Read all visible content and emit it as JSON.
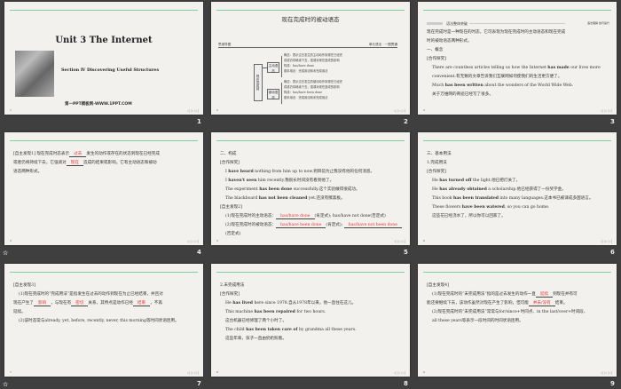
{
  "slide_numbers": [
    "1",
    "2",
    "3",
    "4",
    "5",
    "6",
    "7",
    "8",
    "9"
  ],
  "animation_icon": "star-icon",
  "slide1": {
    "title": "Unit 3    The Internet",
    "subtitle": "Section Ⅳ Discovering Useful Structures",
    "footer": "第一PPT模板网-WWW.1PPT.COM"
  },
  "slide2": {
    "title": "现在完成时的被动语态",
    "header_left": "思维导图",
    "header_right": "单元语法 · 一图贯通",
    "center": "现在完成时",
    "branches": [
      {
        "label": "主动语态",
        "items": [
          "概念：表示过去发生的主动动作到现在已经完",
          "成或仍将继续下去，强调对现在造成的影响",
          "构成：has/have done",
          "基本用法：完成用法和未完成用法"
        ]
      },
      {
        "label": "被动语态",
        "items": [
          "概念：表示过去发生的被动动作到现在已经完",
          "成或仍将继续下去，强调对现在造成的影响",
          "构成：has/have been done",
          "基本用法：完成用法和未完成用法"
        ]
      }
    ]
  },
  "slide3": {
    "header": "语法整体突破",
    "header_right": "语法理解 技巧提升"
  },
  "slides": {
    "3": [
      [
        [
          "  现在完成时是一种现在的时态，它可表现为现在完成时的主动语态和现在完成",
          ""
        ]
      ],
      [
        [
          "时的被动语态两种形式。",
          ""
        ]
      ],
      [
        [
          "一、概念",
          ""
        ]
      ],
      [
        [
          "[合作探究]",
          ""
        ]
      ],
      [
        [
          "There are countless articles telling us how the Internet ",
          ""
        ],
        [
          "has made",
          "b"
        ],
        [
          " our lives more",
          ""
        ]
      ],
      [
        [
          "convenient.有无数的文章告诉我们互联网如何使我们的生活更方便了。",
          ""
        ]
      ],
      [
        [
          "Much ",
          ""
        ],
        [
          "has been written",
          "b"
        ],
        [
          " about the wonders of the World Wide Web.",
          ""
        ]
      ],
      [
        [
          "关于万维网的奇迹已经写了很多。",
          ""
        ]
      ]
    ],
    "4": [
      [
        [
          "[自主发现1]  现在完成时态表示",
          ""
        ],
        [
          "过去",
          "r"
        ],
        [
          "发生的动作或存在的状态到现在已经完成",
          ""
        ]
      ],
      [
        [
          "  或者仍将持续下去。它强调对",
          ""
        ],
        [
          "现在",
          "r"
        ],
        [
          "造成的结果或影响。它有主动语态和被动",
          ""
        ]
      ],
      [
        [
          "  语态两种形式。",
          ""
        ]
      ]
    ],
    "5": [
      [
        [
          "二、构成",
          ""
        ]
      ],
      [
        [
          "[合作探究]",
          ""
        ]
      ],
      [
        [
          "I ",
          ""
        ],
        [
          "have heard",
          "b"
        ],
        [
          " nothing from him up to now.到目前为止我没有他的任何消息。",
          ""
        ]
      ],
      [
        [
          "I ",
          ""
        ],
        [
          "haven't seen",
          "b"
        ],
        [
          " him recently.我很长时间没有看到他了。",
          ""
        ]
      ],
      [
        [
          "The experiment ",
          ""
        ],
        [
          "has been done",
          "b"
        ],
        [
          " successfully.这个实验做得很成功。",
          ""
        ]
      ],
      [
        [
          "The blackboard ",
          ""
        ],
        [
          "has not been cleaned",
          "b"
        ],
        [
          " yet.还没有擦黑板。",
          ""
        ]
      ],
      [
        [
          "[自主发现2]",
          ""
        ]
      ],
      [
        [
          "(1)现在完成时的主动语态：",
          ""
        ],
        [
          "has/have done",
          "r"
        ],
        [
          "(肯定式); has/have not done(否定式)",
          ""
        ]
      ],
      [
        [
          "(2)现在完成时的被动语态：",
          ""
        ],
        [
          "has/have been done",
          "r"
        ],
        [
          "(肯定式); ",
          ""
        ],
        [
          "has/have not been done",
          "r"
        ]
      ],
      [
        [
          "(否定式)",
          ""
        ]
      ]
    ],
    "6": [
      [
        [
          "三、基本用法",
          ""
        ]
      ],
      [
        [
          "1.完成用法",
          ""
        ]
      ],
      [
        [
          "[合作探究]",
          ""
        ]
      ],
      [
        [
          "He ",
          ""
        ],
        [
          "has turned off",
          "b"
        ],
        [
          " the light.他已把灯关了。",
          ""
        ]
      ],
      [
        [
          "He ",
          ""
        ],
        [
          "has already obtained",
          "b"
        ],
        [
          " a scholarship.他已经获得了一份奖学金。",
          ""
        ]
      ],
      [
        [
          "This book ",
          ""
        ],
        [
          "has been translated",
          "b"
        ],
        [
          " into many languages.这本书已被译成多国语言。",
          ""
        ]
      ],
      [
        [
          "These flowers ",
          ""
        ],
        [
          "have been watered",
          "b"
        ],
        [
          ", so you can go home.",
          ""
        ]
      ],
      [
        [
          "这些花已经浇水了，所以你可以回家了。",
          ""
        ]
      ]
    ],
    "7": [
      [
        [
          "[自主发现3]",
          ""
        ]
      ],
      [
        [
          "(1)现在完成时的“完成用法”是指发生在过去的动作到现在为止已经结束，并且对",
          ""
        ]
      ],
      [
        [
          "现在产生了",
          ""
        ],
        [
          "影响",
          "r"
        ],
        [
          "，与现在有",
          ""
        ],
        [
          "密切",
          "r"
        ],
        [
          "关系，其特点是动作已经",
          ""
        ],
        [
          "结束",
          "r"
        ],
        [
          "，不再",
          ""
        ]
      ],
      [
        [
          "延续。",
          ""
        ]
      ],
      [
        [
          "(2)该时态常与already, yet, before, recently, never, this morning等时间状语连用。",
          ""
        ]
      ]
    ],
    "8": [
      [
        [
          "2.未完成用法",
          ""
        ]
      ],
      [
        [
          "[合作探究]",
          ""
        ]
      ],
      [
        [
          "He ",
          ""
        ],
        [
          "has lived",
          "b"
        ],
        [
          " here since 1978.自从1978年以来，他一直住在这儿。",
          ""
        ]
      ],
      [
        [
          "This machine ",
          ""
        ],
        [
          "has been repaired",
          "b"
        ],
        [
          " for two hours.",
          ""
        ]
      ],
      [
        [
          "这台机器已经修理了两个小时了。",
          ""
        ]
      ],
      [
        [
          "The child ",
          ""
        ],
        [
          "has been taken care of",
          "b"
        ],
        [
          " by grandma all these years.",
          ""
        ]
      ],
      [
        [
          "这些年来，孩子一直由奶奶照看。",
          ""
        ]
      ]
    ],
    "9": [
      [
        [
          "[自主发现4]",
          ""
        ]
      ],
      [
        [
          "(1)现在完成时的“未完成用法”指的是过去发生的动作一直",
          ""
        ],
        [
          "延续",
          "r"
        ],
        [
          "到现在并有可",
          ""
        ]
      ],
      [
        [
          "能还要继续下去，该动作虽然对现在产生了影响，但可能",
          ""
        ],
        [
          "并未/没有",
          "r"
        ],
        [
          "结束。",
          ""
        ]
      ],
      [
        [
          "(2)现在完成时的“未完成用法”常常与for/since+时间点、in the last/over+时间段、",
          ""
        ]
      ],
      [
        [
          "all these years等表示一段时间的时间状语连用。",
          ""
        ]
      ]
    ]
  }
}
